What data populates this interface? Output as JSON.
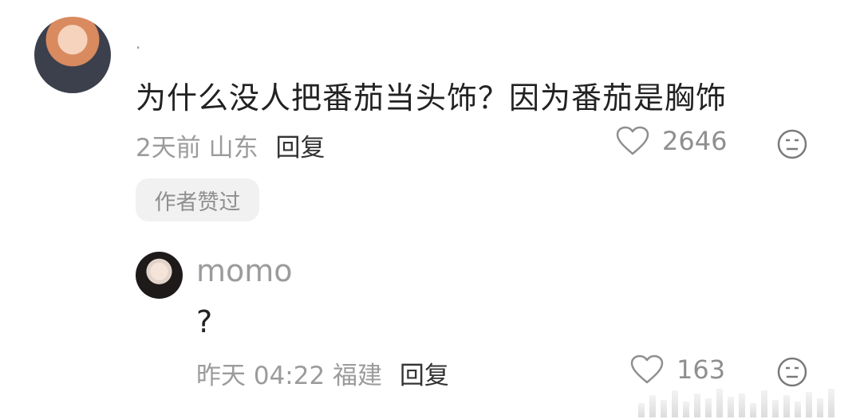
{
  "comment": {
    "username": ".",
    "text": "为什么没人把番茄当头饰？因为番茄是胸饰",
    "time_location": "2天前 山东",
    "reply_label": "回复",
    "likes": "2646",
    "badge": "作者赞过"
  },
  "reply": {
    "username": "momo",
    "text": "?",
    "time_location": "昨天 04:22 福建",
    "reply_label": "回复",
    "likes": "163"
  },
  "icons": {
    "like": "heart-outline-icon",
    "reaction": "neutral-face-icon"
  },
  "colors": {
    "meta_gray": "#9b9b9b",
    "text_dark": "#222222",
    "badge_bg": "#f1f1f1"
  }
}
